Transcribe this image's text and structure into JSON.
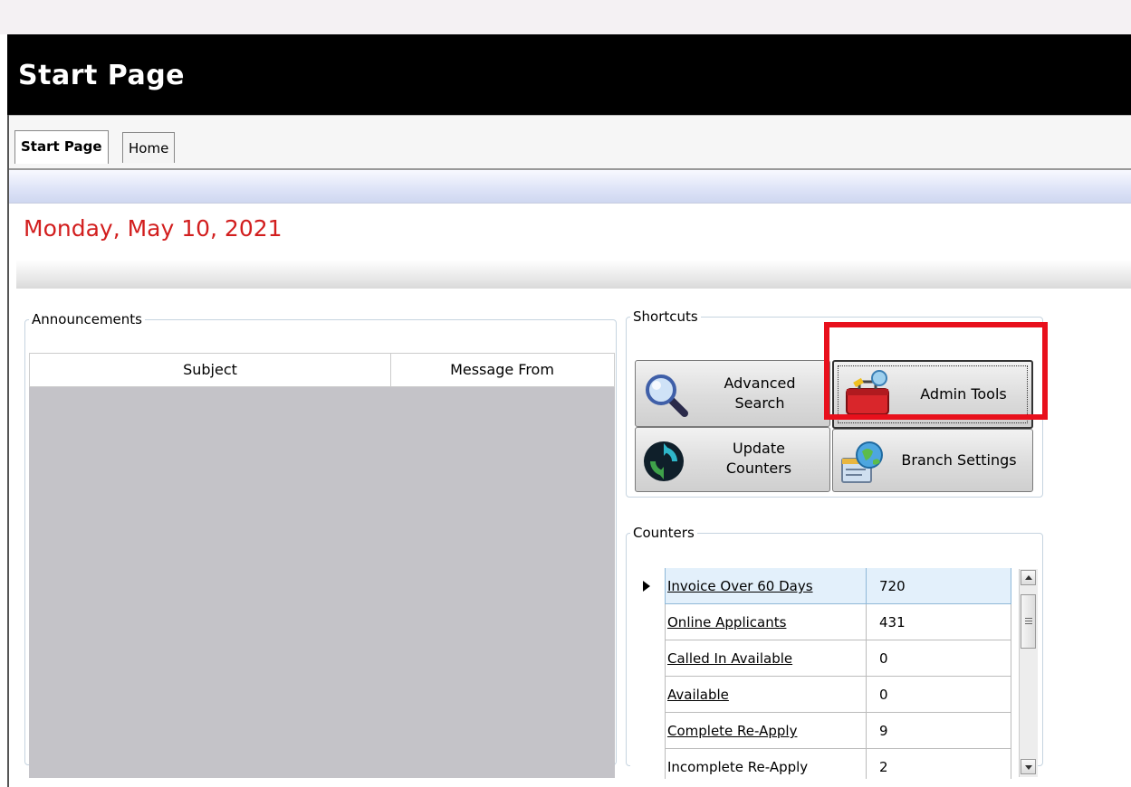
{
  "window": {
    "title": "Start Page"
  },
  "tabs": [
    {
      "label": "Start Page",
      "active": true
    },
    {
      "label": "Home",
      "active": false
    }
  ],
  "date_text": "Monday, May 10, 2021",
  "announcements": {
    "legend": "Announcements",
    "columns": [
      "Subject",
      "Message From"
    ]
  },
  "shortcuts": {
    "legend": "Shortcuts",
    "buttons": [
      {
        "label_line1": "Advanced",
        "label_line2": "Search",
        "icon": "magnifier-icon"
      },
      {
        "label_line1": "Admin Tools",
        "label_line2": "",
        "icon": "toolbox-icon"
      },
      {
        "label_line1": "Update",
        "label_line2": "Counters",
        "icon": "refresh-icon"
      },
      {
        "label_line1": "Branch Settings",
        "label_line2": "",
        "icon": "branch-globe-icon"
      }
    ]
  },
  "counters": {
    "legend": "Counters",
    "rows": [
      {
        "name": "Invoice Over 60 Days",
        "value": "720",
        "selected": true
      },
      {
        "name": "Online Applicants",
        "value": "431",
        "selected": false
      },
      {
        "name": "Called In Available",
        "value": "0",
        "selected": false
      },
      {
        "name": "Available",
        "value": "0",
        "selected": false
      },
      {
        "name": "Complete Re-Apply",
        "value": "9",
        "selected": false
      },
      {
        "name": "Incomplete Re-Apply",
        "value": "2",
        "selected": false
      }
    ]
  },
  "colors": {
    "title_bar": "#000000",
    "date_text": "#d21e1e",
    "highlight_box": "#e8101c",
    "selected_row": "#e3f0fb"
  }
}
